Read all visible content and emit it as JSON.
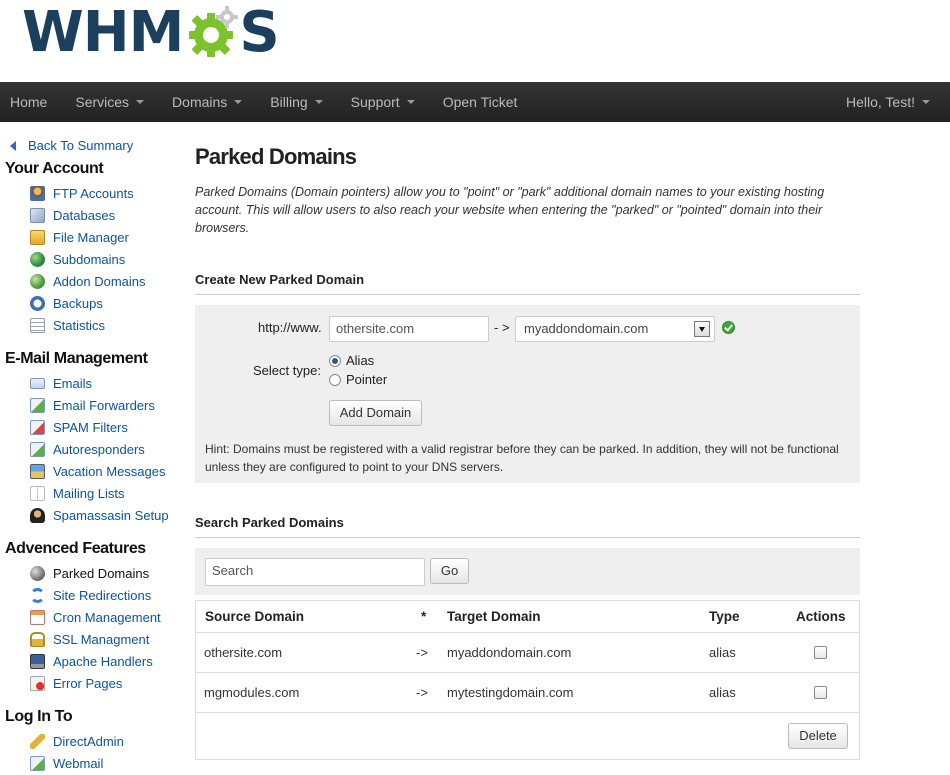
{
  "logo": {
    "left": "WHM",
    "right": "S"
  },
  "nav": {
    "items": [
      {
        "label": "Home",
        "caret": false
      },
      {
        "label": "Services",
        "caret": true
      },
      {
        "label": "Domains",
        "caret": true
      },
      {
        "label": "Billing",
        "caret": true
      },
      {
        "label": "Support",
        "caret": true
      },
      {
        "label": "Open Ticket",
        "caret": false
      }
    ],
    "user": "Hello, Test!"
  },
  "sidebar": {
    "back": "Back To Summary",
    "sections": [
      {
        "heading": "Your Account",
        "items": [
          "FTP Accounts",
          "Databases",
          "File Manager",
          "Subdomains",
          "Addon Domains",
          "Backups",
          "Statistics"
        ]
      },
      {
        "heading": "E-Mail Management",
        "items": [
          "Emails",
          "Email Forwarders",
          "SPAM Filters",
          "Autoresponders",
          "Vacation Messages",
          "Mailing Lists",
          "Spamassasin Setup"
        ]
      },
      {
        "heading": "Advenced Features",
        "items": [
          "Parked Domains",
          "Site Redirections",
          "Cron Management",
          "SSL Managment",
          "Apache Handlers",
          "Error Pages"
        ]
      },
      {
        "heading": "Log In To",
        "items": [
          "DirectAdmin",
          "Webmail"
        ]
      }
    ]
  },
  "main": {
    "title": "Parked Domains",
    "description": "Parked Domains (Domain pointers) allow you to \"point\" or \"park\" additional domain names to your existing hosting account. This will allow users to also reach your website when entering the \"parked\" or \"pointed\" domain into their browsers.",
    "create": {
      "title": "Create New Parked Domain",
      "prefix_label": "http://www.",
      "domain_value": "othersite.com",
      "arrow": "- >",
      "target_selected": "myaddondomain.com",
      "type_label": "Select type:",
      "type_options": [
        "Alias",
        "Pointer"
      ],
      "selected_type": "Alias",
      "add_button": "Add Domain",
      "hint": "Hint: Domains must be registered with a valid registrar before they can be parked. In addition, they will not be functional unless they are configured to point to your DNS servers."
    },
    "search": {
      "title": "Search Parked Domains",
      "placeholder": "Search",
      "go_button": "Go"
    },
    "table": {
      "columns": [
        "Source Domain",
        "*",
        "Target Domain",
        "Type",
        "Actions"
      ],
      "rows": [
        {
          "source": "othersite.com",
          "arrow": "->",
          "target": "myaddondomain.com",
          "type": "alias"
        },
        {
          "source": "mgmodules.com",
          "arrow": "->",
          "target": "mytestingdomain.com",
          "type": "alias"
        }
      ],
      "delete_button": "Delete"
    }
  },
  "colors": {
    "navbar": "#2c2c2c",
    "link": "#0a55a0",
    "logo": "#1d3f5e",
    "gear": "#7cc22c",
    "panel": "#efefef"
  }
}
